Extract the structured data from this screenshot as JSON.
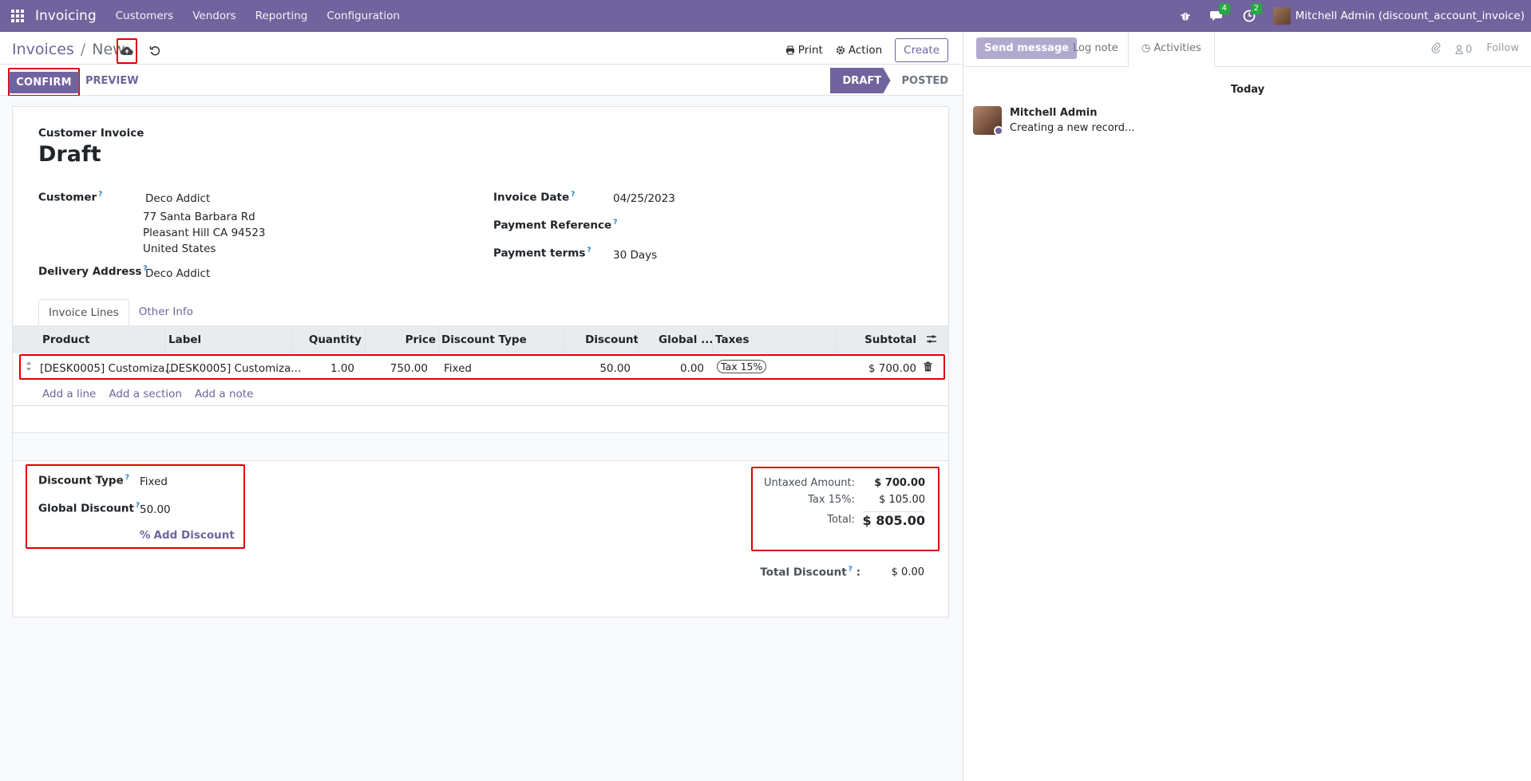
{
  "navbar": {
    "app_name": "Invoicing",
    "menu": [
      "Customers",
      "Vendors",
      "Reporting",
      "Configuration"
    ],
    "messages_badge": "4",
    "activities_badge": "2",
    "user": "Mitchell Admin (discount_account_invoice)"
  },
  "breadcrumb": {
    "parent": "Invoices",
    "current": "New"
  },
  "control_panel": {
    "print": "Print",
    "action": "Action",
    "create": "Create"
  },
  "statusbar": {
    "confirm": "CONFIRM",
    "preview": "PREVIEW",
    "stages": [
      "DRAFT",
      "POSTED"
    ],
    "active_stage": "DRAFT"
  },
  "form": {
    "doc_type": "Customer Invoice",
    "title": "Draft",
    "customer_label": "Customer",
    "customer_name": "Deco Addict",
    "address": [
      "77 Santa Barbara Rd",
      "Pleasant Hill CA 94523",
      "United States"
    ],
    "delivery_label": "Delivery Address",
    "delivery_value": "Deco Addict",
    "invoice_date_label": "Invoice Date",
    "invoice_date": "04/25/2023",
    "payment_ref_label": "Payment Reference",
    "payment_terms_label": "Payment terms",
    "payment_terms": "30 Days"
  },
  "tabs": [
    "Invoice Lines",
    "Other Info"
  ],
  "lines_table": {
    "columns": [
      "Product",
      "Label",
      "Quantity",
      "Price",
      "Discount Type",
      "Discount",
      "Global ...",
      "Taxes",
      "Subtotal"
    ],
    "rows": [
      {
        "product": "[DESK0005] Customiza...",
        "label": "[DESK0005] Customiza...",
        "quantity": "1.00",
        "price": "750.00",
        "discount_type": "Fixed",
        "discount": "50.00",
        "global": "0.00",
        "tax": "Tax 15%",
        "subtotal": "$ 700.00"
      }
    ],
    "add_links": [
      "Add a line",
      "Add a section",
      "Add a note"
    ]
  },
  "discount": {
    "type_label": "Discount Type",
    "type_value": "Fixed",
    "global_label": "Global Discount",
    "global_value": "50.00",
    "add_label": "Add Discount"
  },
  "totals": {
    "untaxed_label": "Untaxed Amount:",
    "untaxed": "$ 700.00",
    "tax_label": "Tax 15%:",
    "tax": "$ 105.00",
    "total_label": "Total:",
    "total": "$ 805.00",
    "total_discount_label": "Total Discount",
    "total_discount": "$ 0.00"
  },
  "chatter": {
    "send_message": "Send message",
    "log_note": "Log note",
    "activities": "Activities",
    "followers_count": "0",
    "follow": "Follow",
    "date_sep": "Today",
    "author": "Mitchell Admin",
    "message": "Creating a new record..."
  }
}
